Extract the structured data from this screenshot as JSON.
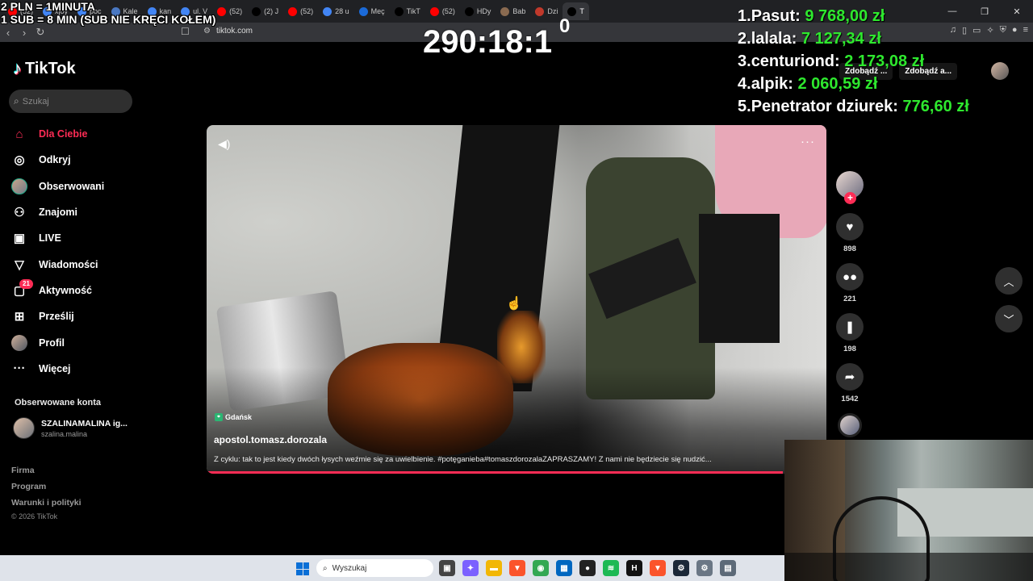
{
  "browser": {
    "tabs": [
      {
        "label": "(52)",
        "color": "#ff0000",
        "icon": "youtube-icon"
      },
      {
        "label": "xjoy",
        "color": "#4285f4",
        "icon": "google-icon"
      },
      {
        "label": "poc",
        "color": "#4285f4",
        "icon": "google-icon"
      },
      {
        "label": "Kale",
        "color": "#4a78c2",
        "icon": "calendar-icon"
      },
      {
        "label": "kan",
        "color": "#4285f4",
        "icon": "google-icon"
      },
      {
        "label": "ul. V",
        "color": "#4285f4",
        "icon": "google-icon"
      },
      {
        "label": "(52)",
        "color": "#ff0000",
        "icon": "youtube-icon"
      },
      {
        "label": "(2) J",
        "color": "#000000",
        "icon": "x-icon"
      },
      {
        "label": "(52)",
        "color": "#ff0000",
        "icon": "youtube-icon"
      },
      {
        "label": "28 u",
        "color": "#4285f4",
        "icon": "google-icon"
      },
      {
        "label": "Meç",
        "color": "#1b6ad8",
        "icon": "site-icon"
      },
      {
        "label": "TikT",
        "color": "#000000",
        "icon": "tiktok-icon"
      },
      {
        "label": "(52)",
        "color": "#ff0000",
        "icon": "youtube-icon"
      },
      {
        "label": "HDy",
        "color": "#000000",
        "icon": "x-icon"
      },
      {
        "label": "Bab",
        "color": "#8a6a50",
        "icon": "site-icon"
      },
      {
        "label": "Dzi",
        "color": "#c0392b",
        "icon": "site-icon"
      },
      {
        "label": "T",
        "color": "#000000",
        "icon": "tiktok-icon"
      }
    ],
    "url": "tiktok.com"
  },
  "overlay": {
    "donation_rule_1": "2 PLN = 1MINUTA",
    "donation_rule_2": "1 SUB = 8 MIN (SUB NIE KRĘCI KOŁEM)",
    "timer": "290:18:1",
    "timer_extra": "0",
    "leaderboard": [
      {
        "rank": "1.",
        "name": "Pasut:",
        "amount": "9 768,00 zł"
      },
      {
        "rank": "2.",
        "name": "lalala:",
        "amount": "7 127,34 zł"
      },
      {
        "rank": "3.",
        "name": "centuriond:",
        "amount": "2 173,08 zł"
      },
      {
        "rank": "4.",
        "name": "alpik:",
        "amount": "2 060,59 zł"
      },
      {
        "rank": "5.",
        "name": "Penetrator dziurek:",
        "amount": "776,60 zł"
      }
    ]
  },
  "tiktok": {
    "logo_text": "TikTok",
    "search_placeholder": "Szukaj",
    "nav": [
      {
        "label": "Dla Ciebie",
        "icon": "home-icon"
      },
      {
        "label": "Odkryj",
        "icon": "compass-icon"
      },
      {
        "label": "Obserwowani",
        "icon": "avatar-icon"
      },
      {
        "label": "Znajomi",
        "icon": "friends-icon"
      },
      {
        "label": "LIVE",
        "icon": "live-icon"
      },
      {
        "label": "Wiadomości",
        "icon": "messages-icon"
      },
      {
        "label": "Aktywność",
        "icon": "activity-icon",
        "badge": "21"
      },
      {
        "label": "Prześlij",
        "icon": "upload-icon"
      },
      {
        "label": "Profil",
        "icon": "profile-icon"
      },
      {
        "label": "Więcej",
        "icon": "more-icon"
      }
    ],
    "followed_title": "Obserwowane konta",
    "followed_account": {
      "name": "SZALINAMALINA ig...",
      "handle": "szalina.malina"
    },
    "footer_links": [
      "Firma",
      "Program",
      "Warunki i polityki"
    ],
    "copyright": "© 2026 TikTok",
    "top_chips": [
      "Zdobądź ...",
      "Zdobądź a..."
    ],
    "video": {
      "location": "Gdańsk",
      "author": "apostol.tomasz.dorozala",
      "description": "Z cyklu: tak to jest kiedy dwóch łysych weźmie się za uwielbienie. #potęganieba#tomaszdorozalaZAPRASZAMY! Z nami nie będziecie się nudzić...",
      "progress": 0.93
    },
    "actions": {
      "likes": "898",
      "comments": "221",
      "saves": "198",
      "shares": "1542"
    }
  },
  "taskbar": {
    "search_placeholder": "Wyszukaj",
    "apps": [
      {
        "name": "task-view",
        "color": "#444444",
        "glyph": "▣"
      },
      {
        "name": "copilot",
        "color": "#7b61ff",
        "glyph": "✦"
      },
      {
        "name": "file-explorer",
        "color": "#f2b705",
        "glyph": "▬"
      },
      {
        "name": "brave",
        "color": "#fb542b",
        "glyph": "▼"
      },
      {
        "name": "chrome",
        "color": "#34a853",
        "glyph": "◉"
      },
      {
        "name": "store",
        "color": "#0067c0",
        "glyph": "▦"
      },
      {
        "name": "app-dark",
        "color": "#222222",
        "glyph": "●"
      },
      {
        "name": "spotify",
        "color": "#1db954",
        "glyph": "≋"
      },
      {
        "name": "heaven",
        "color": "#111111",
        "glyph": "H"
      },
      {
        "name": "brave-2",
        "color": "#fb542b",
        "glyph": "▼"
      },
      {
        "name": "steam",
        "color": "#1b2838",
        "glyph": "⚙"
      },
      {
        "name": "settings",
        "color": "#6b7785",
        "glyph": "⚙"
      },
      {
        "name": "calculator",
        "color": "#5d6a78",
        "glyph": "▤"
      }
    ]
  }
}
